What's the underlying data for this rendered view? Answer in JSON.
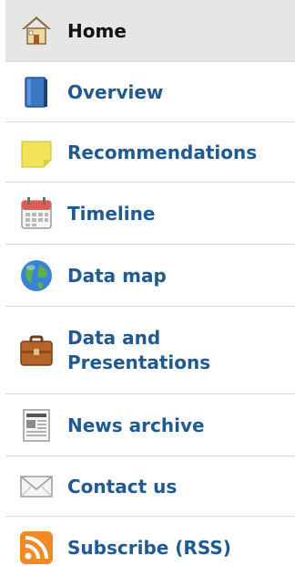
{
  "nav": {
    "items": [
      {
        "label": "Home",
        "icon": "home-icon"
      },
      {
        "label": "Overview",
        "icon": "book-icon"
      },
      {
        "label": "Recommendations",
        "icon": "note-icon"
      },
      {
        "label": "Timeline",
        "icon": "calendar-icon"
      },
      {
        "label": "Data map",
        "icon": "globe-icon"
      },
      {
        "label_line1": "Data and",
        "label_line2": "Presentations",
        "icon": "briefcase-icon"
      },
      {
        "label": "News archive",
        "icon": "newspaper-icon"
      },
      {
        "label": "Contact us",
        "icon": "envelope-icon"
      },
      {
        "label": "Subscribe (RSS)",
        "icon": "rss-icon"
      }
    ],
    "active_index": 0
  },
  "colors": {
    "link": "#1f5a92",
    "active_text": "#111111",
    "active_bg": "#e6e6e6",
    "divider": "#dcdcdc"
  }
}
